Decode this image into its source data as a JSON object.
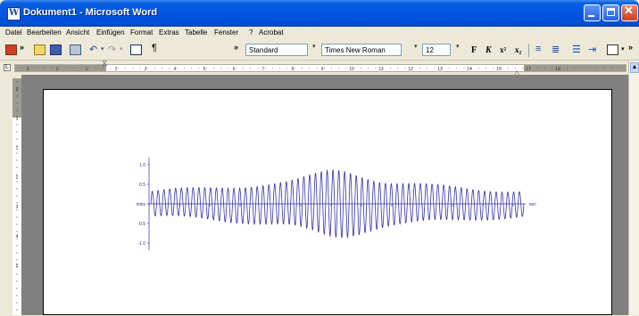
{
  "window": {
    "title": "Dokument1 - Microsoft Word"
  },
  "menu": [
    "Datei",
    "Bearbeiten",
    "Ansicht",
    "Einfügen",
    "Format",
    "Extras",
    "Tabelle",
    "Fenster",
    "?",
    "Acrobat"
  ],
  "toolbar": {
    "style": "Standard",
    "font": "Times New Roman",
    "size": "12",
    "bold": "F",
    "italic": "K"
  },
  "ruler": {
    "labels": [
      "2",
      "1",
      "1",
      "2",
      "3",
      "4",
      "5",
      "6",
      "7",
      "8",
      "9",
      "10",
      "11",
      "12",
      "13",
      "14",
      "15",
      "17",
      "18"
    ]
  },
  "vruler": {
    "labels": [
      "2",
      "1",
      "1",
      "2",
      "3",
      "4",
      "5"
    ]
  },
  "chart_data": {
    "type": "line",
    "yticks": [
      "1.0",
      "0.5",
      "mins",
      "-0.5",
      "-1.0"
    ],
    "xunit": "sec",
    "ylim": [
      -1.0,
      1.0
    ],
    "series": [
      {
        "name": "",
        "color": "#3333AA"
      }
    ]
  }
}
